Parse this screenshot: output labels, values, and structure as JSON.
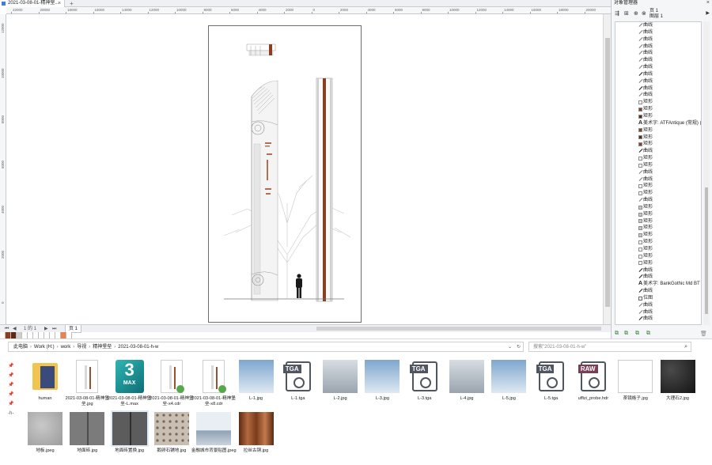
{
  "document_tab": {
    "title": "2021-03-08-01-精神堡..."
  },
  "ruler": {
    "h_labels": [
      "22000",
      "20000",
      "18000",
      "16000",
      "14000",
      "12000",
      "10000",
      "8000",
      "6000",
      "4000",
      "2000",
      "0",
      "2000",
      "4000",
      "6000",
      "8000",
      "10000",
      "12000",
      "14000",
      "16000",
      "18000",
      "20000"
    ],
    "v_labels": [
      "12000",
      "10000",
      "8000",
      "6000",
      "4000",
      "2000",
      "0"
    ]
  },
  "page_nav": {
    "page_label": "1 的 1",
    "page_tab": "页 1"
  },
  "object_manager": {
    "title": "对象管理器",
    "page": "页 1",
    "layer": "图层 1",
    "items": [
      {
        "type": "curve",
        "label": "曲线"
      },
      {
        "type": "curve",
        "label": "曲线"
      },
      {
        "type": "curve",
        "label": "曲线"
      },
      {
        "type": "curve",
        "label": "曲线"
      },
      {
        "type": "curve",
        "label": "曲线"
      },
      {
        "type": "curve",
        "label": "曲线"
      },
      {
        "type": "curve",
        "label": "曲线"
      },
      {
        "type": "curve-dark",
        "label": "曲线"
      },
      {
        "type": "curve",
        "label": "曲线"
      },
      {
        "type": "curve-dark",
        "label": "曲线"
      },
      {
        "type": "curve",
        "label": "曲线"
      },
      {
        "type": "rect",
        "label": "矩形",
        "color": "#ffffff"
      },
      {
        "type": "rect",
        "label": "矩形",
        "color": "#8b3f22"
      },
      {
        "type": "rect",
        "label": "矩形",
        "color": "#5e2a16"
      },
      {
        "type": "text",
        "label": "美术字: ATFAntique (常规) (I..."
      },
      {
        "type": "rect",
        "label": "矩形",
        "color": "#8b3f22"
      },
      {
        "type": "rect",
        "label": "矩形",
        "color": "#5e2a16"
      },
      {
        "type": "rect",
        "label": "矩形",
        "color": "#8b3f22"
      },
      {
        "type": "curve-dark",
        "label": "曲线"
      },
      {
        "type": "rect",
        "label": "矩形",
        "color": "#ffffff"
      },
      {
        "type": "rect",
        "label": "矩形",
        "color": "#ffffff"
      },
      {
        "type": "curve",
        "label": "曲线"
      },
      {
        "type": "curve",
        "label": "曲线"
      },
      {
        "type": "rect",
        "label": "矩形",
        "color": "#ffffff"
      },
      {
        "type": "rect",
        "label": "矩形",
        "color": "#ffffff"
      },
      {
        "type": "curve",
        "label": "曲线"
      },
      {
        "type": "rect",
        "label": "矩形",
        "color": "#c9c9c9"
      },
      {
        "type": "rect",
        "label": "矩形",
        "color": "#c9c9c9"
      },
      {
        "type": "rect",
        "label": "矩形",
        "color": "#c9c9c9"
      },
      {
        "type": "rect",
        "label": "矩形",
        "color": "#c9c9c9"
      },
      {
        "type": "rect",
        "label": "矩形",
        "color": "#c9c9c9"
      },
      {
        "type": "rect",
        "label": "矩形",
        "color": "#ffffff"
      },
      {
        "type": "rect",
        "label": "矩形",
        "color": "#ffffff"
      },
      {
        "type": "rect",
        "label": "矩形",
        "color": "#ffffff"
      },
      {
        "type": "rect",
        "label": "矩形",
        "color": "#ffffff"
      },
      {
        "type": "curve-dark",
        "label": "曲线"
      },
      {
        "type": "curve-dark",
        "label": "曲线"
      },
      {
        "type": "text",
        "label": "美术字: BankGothic Md BT (..."
      },
      {
        "type": "curve-dark",
        "label": "曲线"
      },
      {
        "type": "group",
        "label": "位图"
      },
      {
        "type": "curve",
        "label": "曲线"
      },
      {
        "type": "curve",
        "label": "曲线"
      },
      {
        "type": "curve-dark",
        "label": "曲线"
      }
    ]
  },
  "explorer": {
    "breadcrumb": [
      "此电脑",
      "Work (H:)",
      "work",
      "导视",
      "精神堡垒",
      "2021-03-08-01-h-w"
    ],
    "search_placeholder": "搜索\"2021-03-08-01-h-w\"",
    "quick_access": [
      "📌",
      "📌",
      "📌",
      "📌",
      "📌",
      "-h-"
    ],
    "files": [
      {
        "name": "human",
        "kind": "folder"
      },
      {
        "name": "2021-03-08-01-精神堡垒.jpg",
        "kind": "doc"
      },
      {
        "name": "2021-03-08-01-精神堡垒-L.max",
        "kind": "max",
        "badge": "3",
        "sub": "MAX"
      },
      {
        "name": "2021-03-08-01-精神堡垒-x4.cdr",
        "kind": "cdr"
      },
      {
        "name": "2021-03-08-01-精神堡垒-x8.cdr",
        "kind": "cdr"
      },
      {
        "name": "L-1.jpg",
        "kind": "photo-sky"
      },
      {
        "name": "L-1.tga",
        "kind": "ft",
        "badge": "TGA"
      },
      {
        "name": "L-2.jpg",
        "kind": "photo-grey"
      },
      {
        "name": "L-3.jpg",
        "kind": "photo-sky"
      },
      {
        "name": "L-3.tga",
        "kind": "ft",
        "badge": "TGA"
      },
      {
        "name": "L-4.jpg",
        "kind": "photo-grey"
      },
      {
        "name": "L-5.jpg",
        "kind": "photo-sky"
      },
      {
        "name": "L-5.tga",
        "kind": "ft",
        "badge": "TGA"
      },
      {
        "name": "uffizi_probe.hdr",
        "kind": "ft",
        "badge": "RAW"
      },
      {
        "name": "茶镜格子.jpg",
        "kind": "blank"
      },
      {
        "name": "大理石2.jpg",
        "kind": "marble"
      },
      {
        "name": "地板.jpeg",
        "kind": "concrete"
      },
      {
        "name": "地面砖.jpg",
        "kind": "tiles"
      },
      {
        "name": "地面砖置换.jpg",
        "kind": "tiles-dark",
        "selected": true
      },
      {
        "name": "鹅卵石铺地.jpg",
        "kind": "pebbles"
      },
      {
        "name": "金融城市背景贴图.jpeg",
        "kind": "city"
      },
      {
        "name": "拉丝古铜.jpg",
        "kind": "bronze"
      }
    ]
  },
  "colors": {
    "bronze": "#8b3f22",
    "accent": "#3e7fd3"
  }
}
